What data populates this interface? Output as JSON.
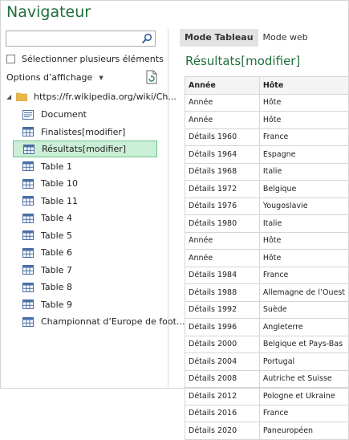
{
  "window": {
    "title": "Navigateur"
  },
  "left": {
    "search": {
      "placeholder": "",
      "value": ""
    },
    "select_multiple_label": "Sélectionner plusieurs éléments",
    "display_options_label": "Options d’affichage",
    "root_label": "https://fr.wikipedia.org/wiki/Ch...",
    "items": [
      {
        "label": "Document",
        "icon": "page-icon",
        "selected": false
      },
      {
        "label": "Finalistes[modifier]",
        "icon": "table-icon",
        "selected": false
      },
      {
        "label": "Résultats[modifier]",
        "icon": "table-icon",
        "selected": true
      },
      {
        "label": "Table 1",
        "icon": "table-icon",
        "selected": false
      },
      {
        "label": "Table 10",
        "icon": "table-icon",
        "selected": false
      },
      {
        "label": "Table 11",
        "icon": "table-icon",
        "selected": false
      },
      {
        "label": "Table 4",
        "icon": "table-icon",
        "selected": false
      },
      {
        "label": "Table 5",
        "icon": "table-icon",
        "selected": false
      },
      {
        "label": "Table 6",
        "icon": "table-icon",
        "selected": false
      },
      {
        "label": "Table 7",
        "icon": "table-icon",
        "selected": false
      },
      {
        "label": "Table 8",
        "icon": "table-icon",
        "selected": false
      },
      {
        "label": "Table 9",
        "icon": "table-icon",
        "selected": false
      },
      {
        "label": "Championnat d’Europe de foot...",
        "icon": "table-icon",
        "selected": false
      }
    ]
  },
  "right": {
    "tabs": [
      "Mode Tableau",
      "Mode web"
    ],
    "active_tab": 0,
    "preview_title": "Résultats[modifier]",
    "columns": [
      "Année",
      "Hôte"
    ],
    "rows": [
      [
        "Année",
        "Hôte"
      ],
      [
        "Année",
        "Hôte"
      ],
      [
        "Détails 1960",
        "France"
      ],
      [
        "Détails 1964",
        "Espagne"
      ],
      [
        "Détails 1968",
        "Italie"
      ],
      [
        "Détails 1972",
        "Belgique"
      ],
      [
        "Détails 1976",
        "Yougoslavie"
      ],
      [
        "Détails 1980",
        "Italie"
      ],
      [
        "Année",
        "Hôte"
      ],
      [
        "Année",
        "Hôte"
      ],
      [
        "Détails 1984",
        "France"
      ],
      [
        "Détails 1988",
        "Allemagne de l’Ouest"
      ],
      [
        "Détails 1992",
        "Suède"
      ],
      [
        "Détails 1996",
        "Angleterre"
      ],
      [
        "Détails 2000",
        "Belgique et Pays-Bas"
      ],
      [
        "Détails 2004",
        "Portugal"
      ],
      [
        "Détails 2008",
        "Autriche et Suisse"
      ],
      [
        "Détails 2012",
        "Pologne et Ukraine"
      ],
      [
        "Détails 2016",
        "France"
      ],
      [
        "Détails 2020",
        "Paneuropéen"
      ]
    ]
  },
  "colors": {
    "accent_green": "#1f6e3c",
    "selection_bg": "#cbeed6",
    "selection_border": "#6dc58c"
  }
}
